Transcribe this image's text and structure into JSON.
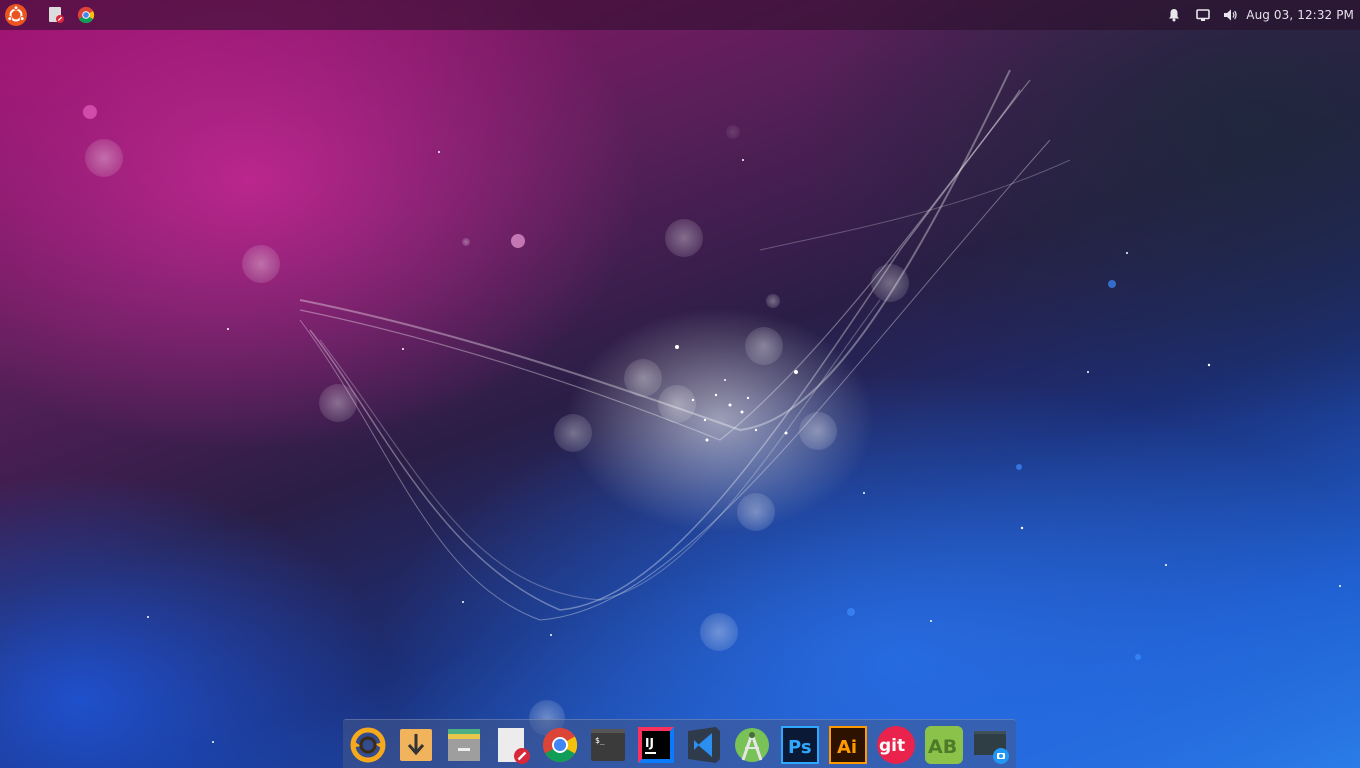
{
  "top_panel": {
    "clock": "Aug 03, 12:32 PM",
    "left_icons": [
      "ubuntu-logo-icon",
      "text-editor-icon",
      "chrome-icon"
    ],
    "tray_icons": [
      "notification-bell-icon",
      "display-icon",
      "volume-icon"
    ]
  },
  "dock": {
    "items": [
      {
        "name": "sync-app-icon",
        "label": ""
      },
      {
        "name": "download-manager-icon",
        "label": ""
      },
      {
        "name": "file-manager-icon",
        "label": ""
      },
      {
        "name": "text-editor-icon",
        "label": ""
      },
      {
        "name": "chrome-icon",
        "label": ""
      },
      {
        "name": "terminal-icon",
        "label": "$_"
      },
      {
        "name": "intellij-icon",
        "label": "IJ"
      },
      {
        "name": "vscode-icon",
        "label": ""
      },
      {
        "name": "android-studio-icon",
        "label": ""
      },
      {
        "name": "photoshop-icon",
        "label": "Ps"
      },
      {
        "name": "illustrator-icon",
        "label": "Ai"
      },
      {
        "name": "git-icon",
        "label": "git"
      },
      {
        "name": "ab-app-icon",
        "label": "AB"
      },
      {
        "name": "screenshot-icon",
        "label": ""
      }
    ]
  },
  "colors": {
    "panel_bg": "#2a0e28",
    "wallpaper_magenta": "#a0106f",
    "wallpaper_blue": "#1f5fd0",
    "photoshop_blue": "#31a8ff",
    "illustrator_orange": "#ff9a00",
    "git_red": "#e9234b",
    "chrome_red": "#db4437",
    "chrome_yellow": "#f4c20d",
    "chrome_green": "#0f9d58",
    "chrome_blue": "#4285f4"
  }
}
